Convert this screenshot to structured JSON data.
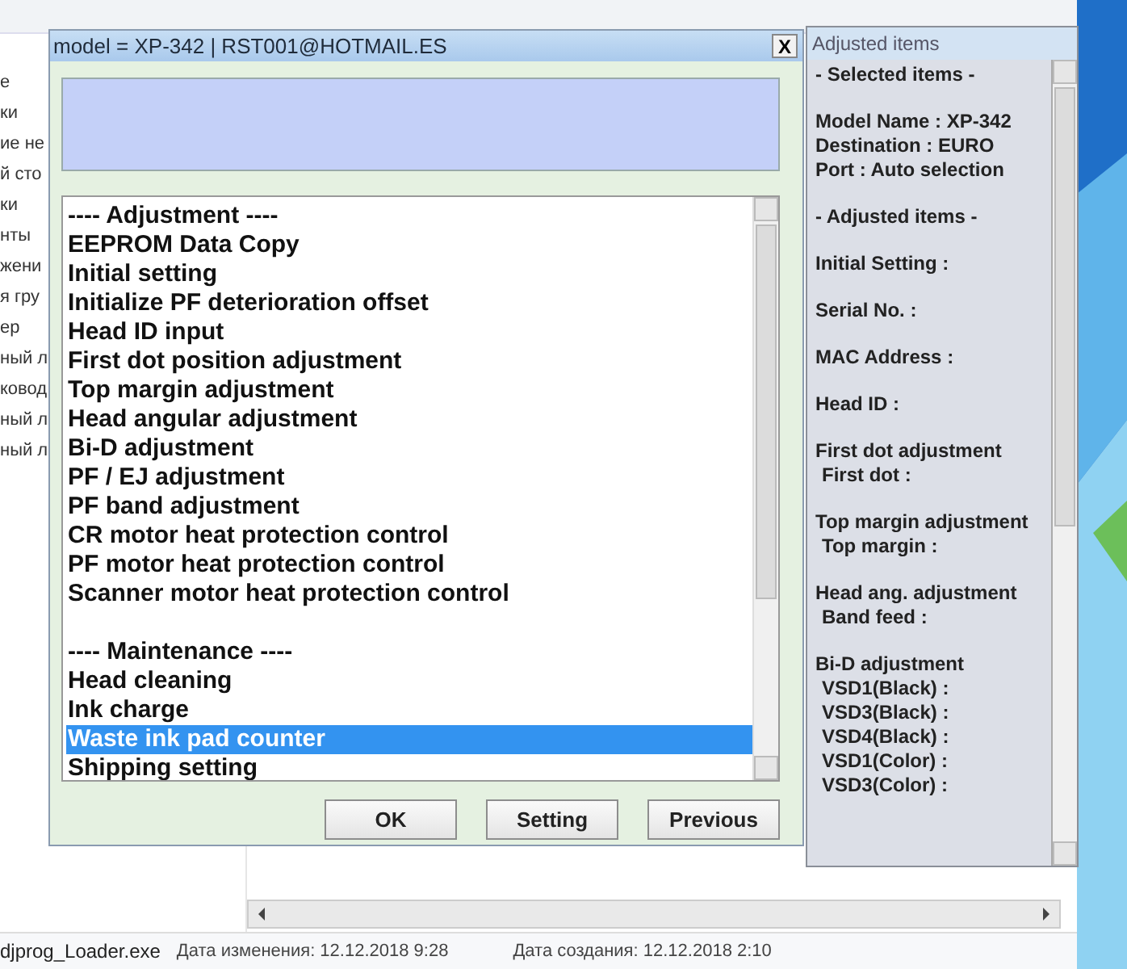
{
  "explorer": {
    "nav_items": [
      "е",
      "ки",
      "ие не",
      "й сто",
      "ки",
      "нты",
      "жени",
      "я гру",
      "ер",
      "ный л",
      "ковод",
      "ный л",
      "ный л"
    ],
    "status_bar": {
      "file_name": "djprog_Loader.exe",
      "modified": "Дата изменения: 12.12.2018 9:28",
      "created": "Дата создания: 12.12.2018 2:10"
    }
  },
  "dialog": {
    "title": "model = XP-342 | RST001@HOTMAIL.ES",
    "close": "X",
    "list": {
      "groups": [
        {
          "heading": "---- Adjustment ----",
          "items": [
            {
              "label": "EEPROM Data Copy",
              "selected": false
            },
            {
              "label": "Initial setting",
              "selected": false
            },
            {
              "label": "Initialize PF deterioration offset",
              "selected": false
            },
            {
              "label": "Head ID input",
              "selected": false
            },
            {
              "label": "First dot position adjustment",
              "selected": false
            },
            {
              "label": "Top margin adjustment",
              "selected": false
            },
            {
              "label": "Head angular adjustment",
              "selected": false
            },
            {
              "label": "Bi-D adjustment",
              "selected": false
            },
            {
              "label": "PF / EJ adjustment",
              "selected": false
            },
            {
              "label": "PF band adjustment",
              "selected": false
            },
            {
              "label": "CR motor heat protection control",
              "selected": false
            },
            {
              "label": "PF motor heat protection control",
              "selected": false
            },
            {
              "label": "Scanner motor heat protection control",
              "selected": false
            }
          ]
        },
        {
          "heading": "---- Maintenance ----",
          "items": [
            {
              "label": "Head cleaning",
              "selected": false
            },
            {
              "label": "Ink charge",
              "selected": false
            },
            {
              "label": "Waste ink pad counter",
              "selected": true
            },
            {
              "label": "Shipping setting",
              "selected": false
            }
          ]
        }
      ]
    },
    "buttons": [
      "OK",
      "Setting",
      "Previous"
    ]
  },
  "adjusted_panel": {
    "title": "Adjusted items",
    "sections": [
      {
        "lines": [
          {
            "text": "- Selected items -",
            "kind": "main"
          }
        ]
      },
      {
        "lines": [
          {
            "text": "Model Name : XP-342",
            "kind": "main"
          },
          {
            "text": "Destination : EURO",
            "kind": "main"
          },
          {
            "text": "Port : Auto selection",
            "kind": "main"
          }
        ]
      },
      {
        "lines": [
          {
            "text": "- Adjusted items -",
            "kind": "main"
          }
        ]
      },
      {
        "lines": [
          {
            "text": "Initial Setting :",
            "kind": "main"
          }
        ]
      },
      {
        "lines": [
          {
            "text": "Serial No. :",
            "kind": "main"
          }
        ]
      },
      {
        "lines": [
          {
            "text": "MAC Address :",
            "kind": "main"
          }
        ]
      },
      {
        "lines": [
          {
            "text": "Head ID :",
            "kind": "main"
          }
        ]
      },
      {
        "lines": [
          {
            "text": "First dot adjustment",
            "kind": "main"
          },
          {
            "text": "First dot :",
            "kind": "sub"
          }
        ]
      },
      {
        "lines": [
          {
            "text": "Top margin adjustment",
            "kind": "main"
          },
          {
            "text": "Top margin :",
            "kind": "sub"
          }
        ]
      },
      {
        "lines": [
          {
            "text": "Head ang. adjustment",
            "kind": "main"
          },
          {
            "text": "Band feed :",
            "kind": "sub"
          }
        ]
      },
      {
        "lines": [
          {
            "text": "Bi-D adjustment",
            "kind": "main"
          },
          {
            "text": "VSD1(Black) :",
            "kind": "sub"
          },
          {
            "text": "VSD3(Black) :",
            "kind": "sub"
          },
          {
            "text": "VSD4(Black) :",
            "kind": "sub"
          },
          {
            "text": "VSD1(Color) :",
            "kind": "sub"
          },
          {
            "text": "VSD3(Color) :",
            "kind": "sub"
          }
        ]
      }
    ]
  }
}
